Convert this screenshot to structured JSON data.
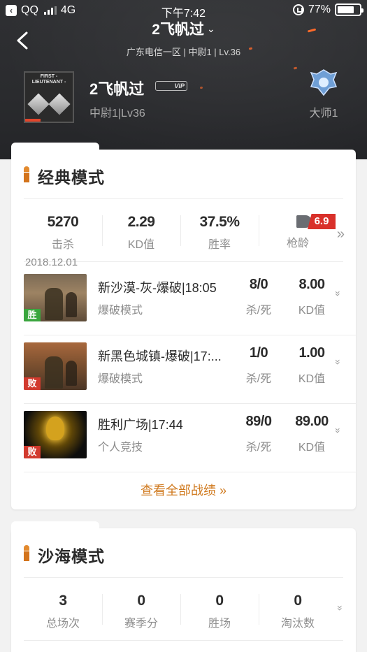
{
  "status_bar": {
    "back_app": "QQ",
    "network": "4G",
    "time": "下午7:42",
    "battery_percent": "77%",
    "battery_level": 0.77
  },
  "header": {
    "title": "2飞帆过",
    "subtitle": "广东电信一区 | 中尉1 | Lv.36"
  },
  "profile": {
    "avatar_rank_text": "FIRST - LIEUTENANT -",
    "name": "2飞帆过",
    "vip_label": "VIP",
    "rank_level": "中尉1|Lv36",
    "tier": "大师1"
  },
  "classic": {
    "title": "经典模式",
    "stats": [
      {
        "value": "5270",
        "label": "击杀"
      },
      {
        "value": "2.29",
        "label": "KD值"
      },
      {
        "value": "37.5%",
        "label": "胜率"
      },
      {
        "value": "6.9",
        "label": "枪龄"
      }
    ],
    "date": "2018.12.01",
    "matches": [
      {
        "name": "新沙漠-灰-爆破|18:05",
        "mode": "爆破模式",
        "kd": "8/0",
        "kd_label": "杀/死",
        "kdr": "8.00",
        "kdr_label": "KD值",
        "result": "胜",
        "thumb": "desert"
      },
      {
        "name": "新黑色城镇-爆破|17:...",
        "mode": "爆破模式",
        "kd": "1/0",
        "kd_label": "杀/死",
        "kdr": "1.00",
        "kdr_label": "KD值",
        "result": "败",
        "thumb": "town"
      },
      {
        "name": "胜利广场|17:44",
        "mode": "个人竞技",
        "kd": "89/0",
        "kd_label": "杀/死",
        "kdr": "89.00",
        "kdr_label": "KD值",
        "result": "败",
        "thumb": "gold"
      }
    ],
    "view_all": "查看全部战绩 »"
  },
  "desert": {
    "title": "沙海模式",
    "stats": [
      {
        "value": "3",
        "label": "总场次"
      },
      {
        "value": "0",
        "label": "赛季分"
      },
      {
        "value": "0",
        "label": "胜场"
      },
      {
        "value": "0",
        "label": "淘汰数"
      }
    ]
  },
  "colors": {
    "accent_orange": "#d07a1f",
    "win_green": "#3aa63e",
    "lose_red": "#d23a2e",
    "header_bg": "#2e2f32"
  }
}
